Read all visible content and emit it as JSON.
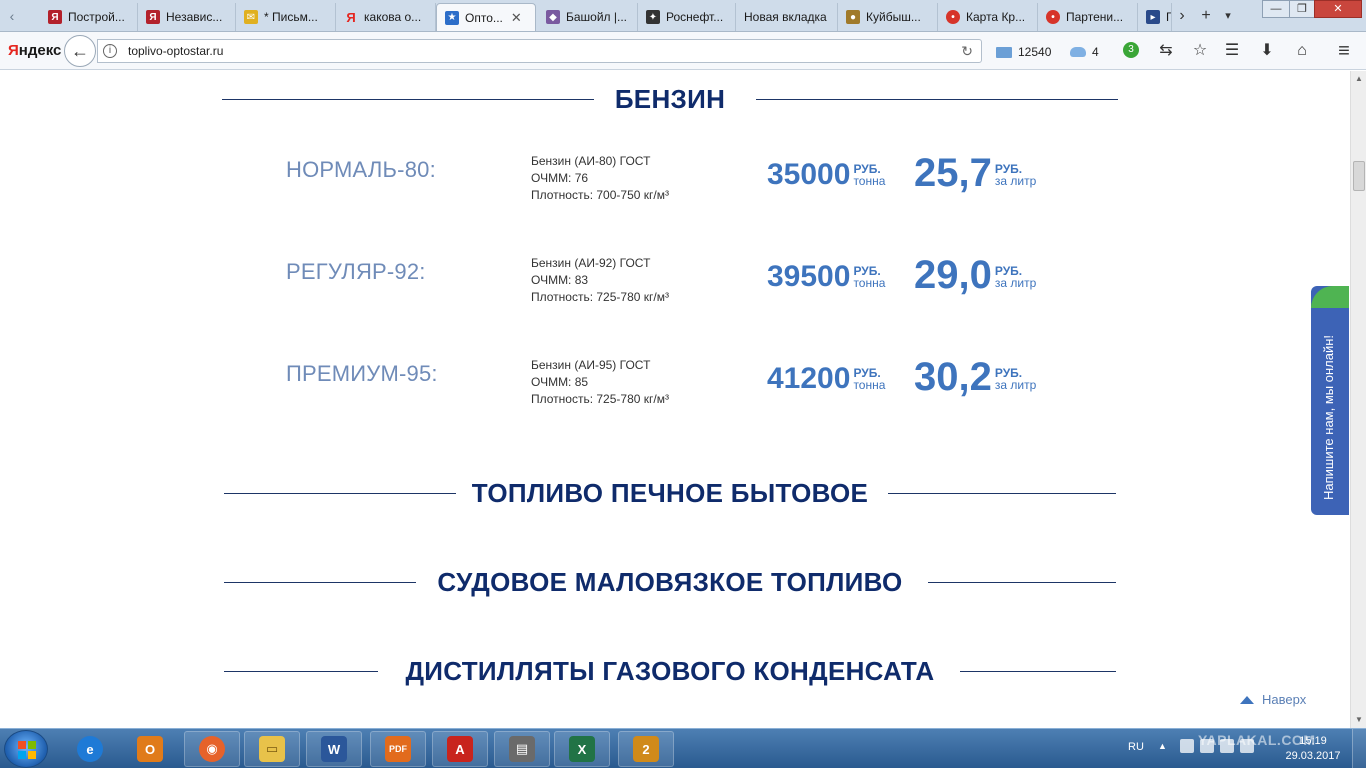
{
  "browser": {
    "tabs": [
      {
        "title": "Построй...",
        "favicon": "yandex-market-icon",
        "color": "#b3212b"
      },
      {
        "title": "Независ...",
        "favicon": "yandex-market-icon",
        "color": "#b3212b"
      },
      {
        "title": "* Письм...",
        "favicon": "mail-envelope-icon",
        "color": "#e0b020"
      },
      {
        "title": "какова о...",
        "favicon": "yandex-search-icon",
        "color": "#e52620"
      },
      {
        "title": "Опто...",
        "favicon": "star-icon",
        "color": "#2d6ec9",
        "active": true
      },
      {
        "title": "Башойл |...",
        "favicon": "bashoil-icon",
        "color": "#7a5aa0"
      },
      {
        "title": "Роснефт...",
        "favicon": "rosneft-icon",
        "color": "#333333"
      },
      {
        "title": "Новая вкладка",
        "favicon": "",
        "color": ""
      },
      {
        "title": "Куйбыш...",
        "favicon": "kuibyshev-icon",
        "color": "#a07a2a"
      },
      {
        "title": "Карта Кр...",
        "favicon": "map-pin-icon",
        "color": "#d6342a"
      },
      {
        "title": "Партени...",
        "favicon": "map-pin-icon",
        "color": "#d6342a"
      },
      {
        "title": "Г",
        "favicon": "partial-tab-icon",
        "color": "#2a4a8a"
      }
    ],
    "new_tab_glyph": "+",
    "list_tabs_glyph": "▾",
    "tab_close_glyph": "✕",
    "scroll_left_glyph": "‹",
    "scroll_right_glyph": "›",
    "window": {
      "minimize": "—",
      "maximize": "❐",
      "close": "✕"
    },
    "brand": {
      "first": "Я",
      "rest": "ндекс"
    },
    "back_glyph": "←",
    "info_glyph": "i",
    "reload_glyph": "↻",
    "url": "toplivo-optostar.ru",
    "mail_count": "12540",
    "disk_count": "4",
    "notif_badge": "3",
    "tools": {
      "sync": "⇆",
      "bookmark": "☆",
      "reader": "☰",
      "downloads": "⬇",
      "pocket": "⌂",
      "menu": "≡"
    }
  },
  "page": {
    "sections": {
      "benzin": "БЕНЗИН",
      "pechnoe": "ТОПЛИВО ПЕЧНОЕ БЫТОВОЕ",
      "sudovoe": "СУДОВОЕ МАЛОВЯЗКОЕ ТОПЛИВО",
      "distillaty": "ДИСТИЛЛЯТЫ ГАЗОВОГО КОНДЕНСАТА"
    },
    "currency": "РУБ.",
    "per_ton": "тонна",
    "per_litre": "за литр",
    "fuels": [
      {
        "name": "НОРМАЛЬ-80:",
        "spec1": "Бензин (АИ-80) ГОСТ",
        "spec2": "ОЧММ: 76",
        "spec3": "Плотность: 700-750 кг/м³",
        "price_ton": "35000",
        "price_litre": "25,7"
      },
      {
        "name": "РЕГУЛЯР-92:",
        "spec1": "Бензин (АИ-92) ГОСТ",
        "spec2": "ОЧММ: 83",
        "spec3": "Плотность: 725-780 кг/м³",
        "price_ton": "39500",
        "price_litre": "29,0"
      },
      {
        "name": "ПРЕМИУМ-95:",
        "spec1": "Бензин (АИ-95) ГОСТ",
        "spec2": "ОЧММ: 85",
        "spec3": "Плотность: 725-780 кг/м³",
        "price_ton": "41200",
        "price_litre": "30,2"
      }
    ],
    "chat_label": "Напишите нам, мы онлайн!",
    "to_top": "Наверх",
    "scroll_up_glyph": "▲",
    "scroll_down_glyph": "▼"
  },
  "taskbar": {
    "apps": [
      {
        "name": "internet-explorer-icon",
        "label": "e",
        "color": "#1e7ad6"
      },
      {
        "name": "outlook-icon",
        "label": "O",
        "color": "#e07b1a"
      },
      {
        "name": "firefox-icon",
        "label": "◉",
        "color": "#e6622a"
      },
      {
        "name": "explorer-folder-icon",
        "label": "▭",
        "color": "#e8c24a"
      },
      {
        "name": "word-icon",
        "label": "W",
        "color": "#2b579a"
      },
      {
        "name": "pdf-editor-icon",
        "label": "PDF",
        "color": "#e26b1d"
      },
      {
        "name": "acrobat-icon",
        "label": "A",
        "color": "#c8241d"
      },
      {
        "name": "scanner-icon",
        "label": "▤",
        "color": "#6a6a6a"
      },
      {
        "name": "excel-icon",
        "label": "X",
        "color": "#217346"
      },
      {
        "name": "chart-app-icon",
        "label": "2",
        "color": "#d08a1a"
      }
    ],
    "lang": "RU",
    "tray_arrow": "▲",
    "watermark": "YAPLAKAL.COM",
    "time": "15:19",
    "date": "29.03.2017"
  }
}
